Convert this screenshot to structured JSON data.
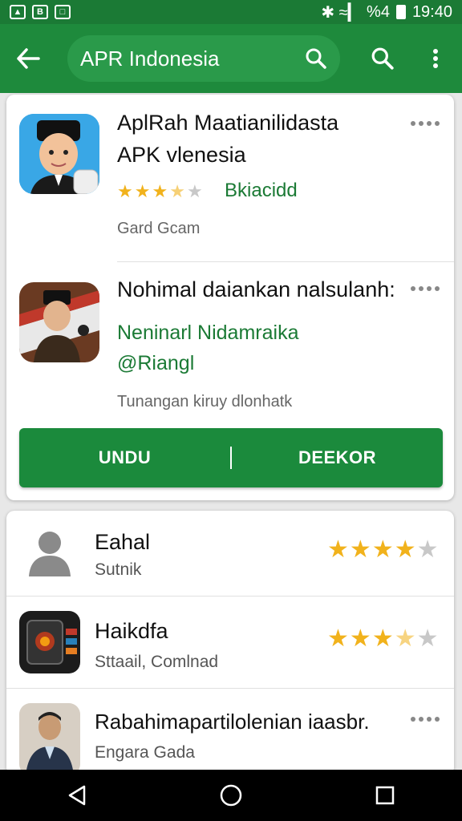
{
  "status_bar": {
    "left_icons": [
      "notification-icon",
      "b-icon",
      "gallery-icon"
    ],
    "signal": "✱≈▎",
    "battery_pct": "%4",
    "time": "19:40"
  },
  "app_bar": {
    "search_query": "APR Indonesia"
  },
  "results": [
    {
      "title_line1": "AplRah Maatianilidasta",
      "title_line2": "APK vlenesia",
      "developer": "Bkiacidd",
      "rating": 3.5,
      "meta": "Gard Gcam"
    },
    {
      "title_line1": "Nohimal daiankan nalsulanh:",
      "developer": "Neninarl Nidamraika",
      "badge": "@Riangl",
      "meta": "Tunangan kiruy dlonhatk"
    }
  ],
  "actions": {
    "left": "UNDU",
    "right": "DEEKOR"
  },
  "list": [
    {
      "title": "Eahal",
      "subtitle": "Sutnik",
      "rating": 4
    },
    {
      "title": "Haikdfa",
      "subtitle": "Sttaail, Comlnad",
      "rating": 3.5
    },
    {
      "title": "Rabahimapartilolenian iaasbr.",
      "subtitle": "Engara Gada"
    }
  ],
  "colors": {
    "app_bar": "#1e8a3c",
    "status_bar": "#1b7a35",
    "accent_green": "#1b7a35",
    "star": "#f1b21c"
  }
}
